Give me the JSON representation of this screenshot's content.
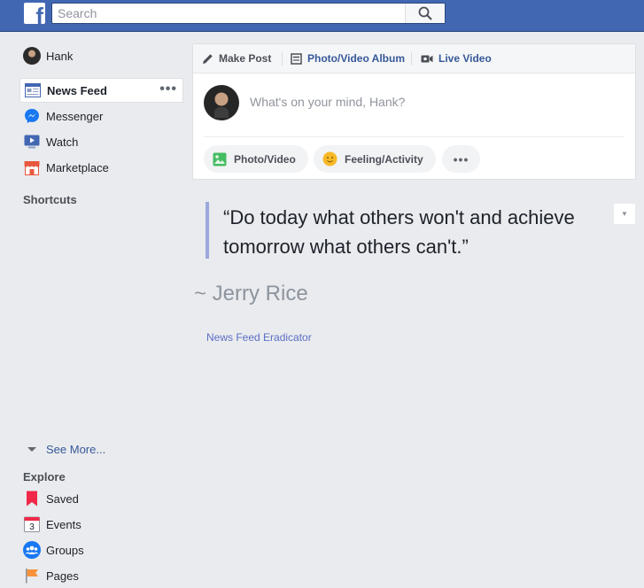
{
  "topbar": {
    "logo": "f",
    "search_placeholder": "Search",
    "search_icon": "search-icon"
  },
  "sidebar": {
    "profile_name": "Hank",
    "items": [
      {
        "label": "News Feed",
        "icon": "news-feed-icon",
        "more": "•••"
      },
      {
        "label": "Messenger",
        "icon": "messenger-icon"
      },
      {
        "label": "Watch",
        "icon": "watch-icon"
      },
      {
        "label": "Marketplace",
        "icon": "marketplace-icon"
      }
    ],
    "shortcuts_heading": "Shortcuts",
    "see_more_label": "See More...",
    "explore_heading": "Explore",
    "explore_items": [
      {
        "label": "Saved",
        "icon": "saved-icon"
      },
      {
        "label": "Events",
        "icon": "events-icon",
        "icon_text": "3"
      },
      {
        "label": "Groups",
        "icon": "groups-icon"
      },
      {
        "label": "Pages",
        "icon": "pages-icon"
      }
    ]
  },
  "composer": {
    "tabs": [
      {
        "label": "Make Post",
        "icon": "pencil-icon"
      },
      {
        "label": "Photo/Video Album",
        "icon": "album-icon"
      },
      {
        "label": "Live Video",
        "icon": "video-camera-icon"
      }
    ],
    "placeholder": "What's on your mind, Hank?",
    "actions": [
      {
        "label": "Photo/Video",
        "icon": "photo-icon"
      },
      {
        "label": "Feeling/Activity",
        "icon": "smiley-icon"
      },
      {
        "label": "•••",
        "icon": "more-icon"
      }
    ]
  },
  "quote": {
    "text": "“Do today what others won't and achieve tomorrow what others can't.”",
    "author": "~ Jerry Rice",
    "source_link": "News Feed Eradicator",
    "menu_glyph": "▼"
  },
  "colors": {
    "brand": "#4267b2",
    "link": "#365899",
    "quote_bar": "#9aa8dc",
    "background": "#e9ebee"
  }
}
